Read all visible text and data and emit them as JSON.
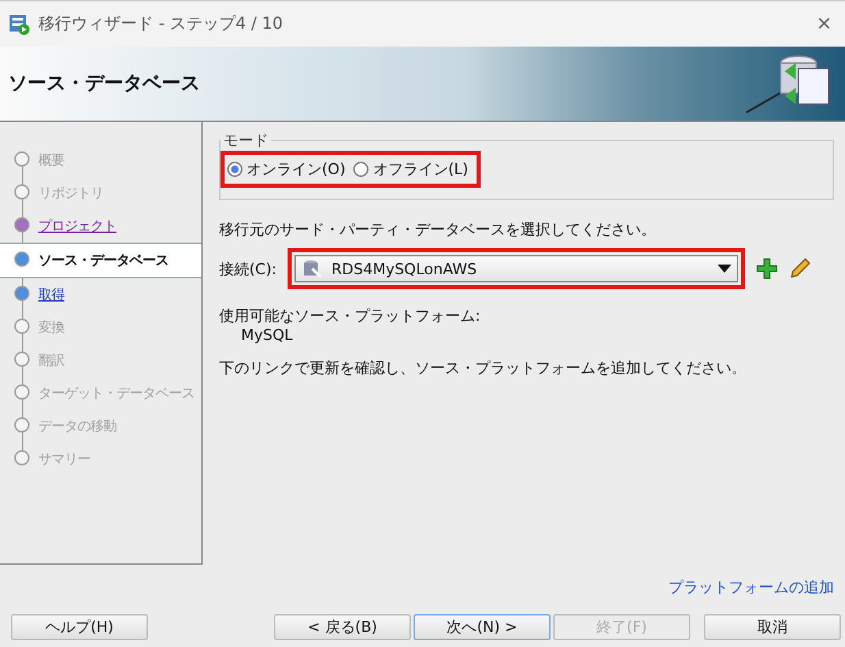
{
  "window": {
    "title": "移行ウィザード - ステップ4 / 10",
    "close": "×"
  },
  "header": {
    "title": "ソース・データベース"
  },
  "steps": [
    {
      "label": "概要",
      "kind": "disabled",
      "selected": false
    },
    {
      "label": "リポジトリ",
      "kind": "disabled",
      "selected": false
    },
    {
      "label": "プロジェクト",
      "kind": "visited",
      "selected": false
    },
    {
      "label": "ソース・データベース",
      "kind": "current",
      "selected": true
    },
    {
      "label": "取得",
      "kind": "link",
      "selected": false
    },
    {
      "label": "変換",
      "kind": "disabled",
      "selected": false
    },
    {
      "label": "翻訳",
      "kind": "disabled",
      "selected": false
    },
    {
      "label": "ターゲット・データベース",
      "kind": "disabled",
      "selected": false
    },
    {
      "label": "データの移動",
      "kind": "disabled",
      "selected": false
    },
    {
      "label": "サマリー",
      "kind": "disabled",
      "selected": false
    }
  ],
  "mode": {
    "legend": "モード",
    "options": [
      {
        "label": "オンライン(O)",
        "selected": true
      },
      {
        "label": "オフライン(L)",
        "selected": false
      }
    ]
  },
  "prompt": "移行元のサード・パーティ・データベースを選択してください。",
  "connection": {
    "label": "接続(C):",
    "value": "RDS4MySQLonAWS"
  },
  "platforms_label": "使用可能なソース・プラットフォーム:",
  "platforms": [
    "MySQL"
  ],
  "hint": "下のリンクで更新を確認し、ソース・プラットフォームを追加してください。",
  "add_platform_link": "プラットフォームの追加",
  "buttons": [
    {
      "label": "ヘルプ(H)",
      "kind": "help",
      "disabled": false,
      "default": false
    },
    {
      "label": "< 戻る(B)",
      "kind": "nav",
      "disabled": false,
      "default": false
    },
    {
      "label": "次へ(N) >",
      "kind": "nav",
      "disabled": false,
      "default": true
    },
    {
      "label": "終了(F)",
      "kind": "nav",
      "disabled": true,
      "default": false
    },
    {
      "label": "取消",
      "kind": "cancel",
      "disabled": false,
      "default": false
    }
  ]
}
